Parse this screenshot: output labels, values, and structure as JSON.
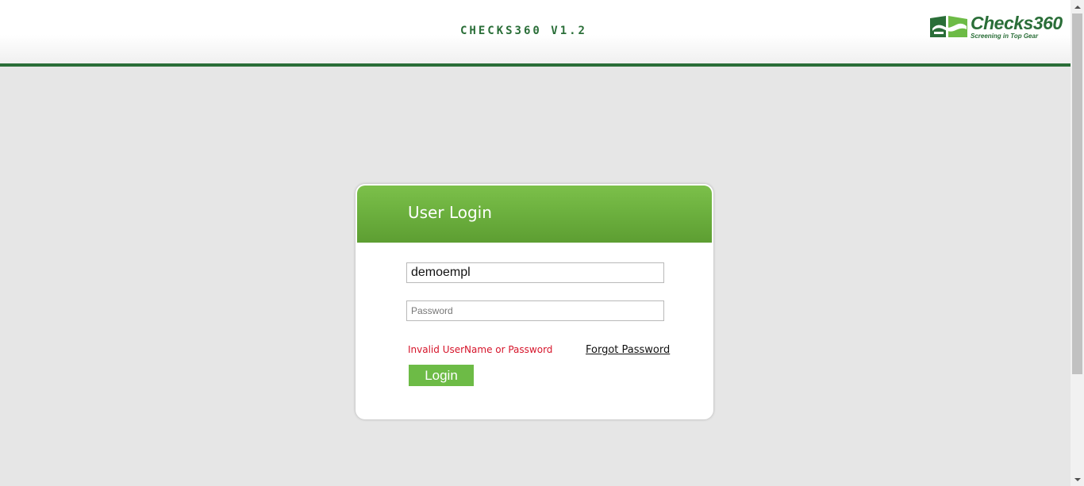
{
  "header": {
    "app_title": "CHECKS360 V1.2",
    "logo_text": "Checks360",
    "logo_tagline": "Screening in Top Gear"
  },
  "login": {
    "title": "User Login",
    "username_value": "demoempl",
    "password_placeholder": "Password",
    "error_message": "Invalid UserName or Password",
    "forgot_password_label": "Forgot Password",
    "login_button_label": "Login"
  },
  "colors": {
    "brand_green": "#2a6e38",
    "header_green": "#6db13f",
    "button_green": "#6dbb46",
    "error_red": "#d6142a",
    "page_background": "#e6e6e6"
  },
  "icons": {
    "logo_mark": "checks360-logo-icon",
    "scroll_up": "chevron-up-icon",
    "scroll_down": "chevron-down-icon"
  }
}
